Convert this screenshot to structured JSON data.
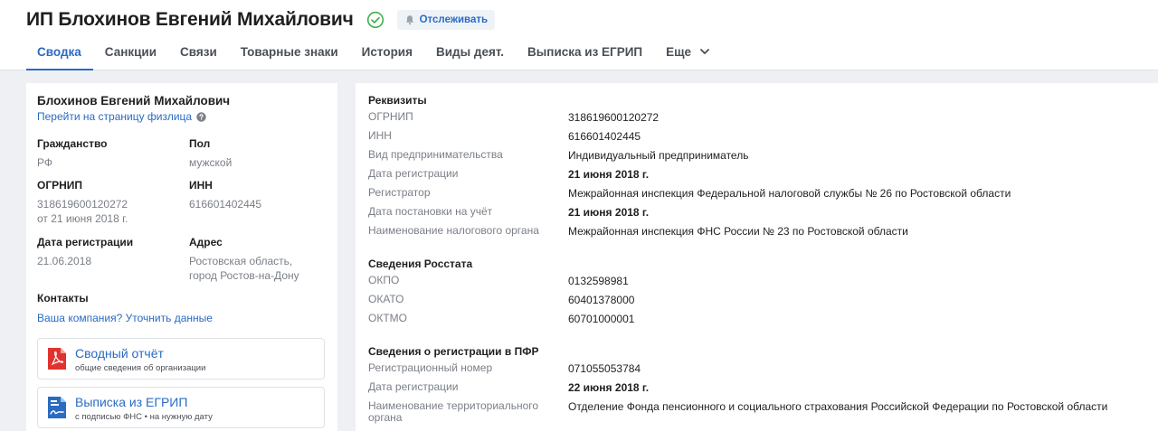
{
  "header": {
    "title": "ИП Блохинов Евгений Михайлович",
    "follow_label": "Отслеживать"
  },
  "tabs": [
    {
      "label": "Сводка"
    },
    {
      "label": "Санкции"
    },
    {
      "label": "Связи"
    },
    {
      "label": "Товарные знаки"
    },
    {
      "label": "История"
    },
    {
      "label": "Виды деят."
    },
    {
      "label": "Выписка из ЕГРИП"
    },
    {
      "label": "Еще"
    }
  ],
  "summary": {
    "name": "Блохинов Евгений Михайлович",
    "person_link": "Перейти на страницу физлица",
    "citizenship_label": "Гражданство",
    "citizenship_value": "РФ",
    "gender_label": "Пол",
    "gender_value": "мужской",
    "ogrnip_label": "ОГРНИП",
    "ogrnip_value": "318619600120272",
    "ogrnip_date": "от 21 июня 2018 г.",
    "inn_label": "ИНН",
    "inn_value": "616601402445",
    "regdate_label": "Дата регистрации",
    "regdate_value": "21.06.2018",
    "address_label": "Адрес",
    "address_line1": "Ростовская область,",
    "address_line2": "город Ростов-на-Дону",
    "contacts_label": "Контакты",
    "contacts_link": "Ваша компания? Уточнить данные",
    "cards": [
      {
        "title": "Сводный отчёт",
        "subtitle": "общие сведения об организации"
      },
      {
        "title": "Выписка из ЕГРИП",
        "subtitle": "с подписью ФНС • на нужную дату"
      }
    ]
  },
  "details": {
    "requisites": {
      "title": "Реквизиты",
      "rows": [
        {
          "key": "ОГРНИП",
          "value": "318619600120272"
        },
        {
          "key": "ИНН",
          "value": "616601402445"
        },
        {
          "key": "Вид предпринимательства",
          "value": "Индивидуальный предприниматель"
        },
        {
          "key": "Дата регистрации",
          "value": "21 июня 2018 г."
        },
        {
          "key": "Регистратор",
          "value": "Межрайонная инспекция Федеральной налоговой службы № 26 по Ростовской области"
        },
        {
          "key": "Дата постановки на учёт",
          "value": "21 июня 2018 г."
        },
        {
          "key": "Наименование налогового органа",
          "value": "Межрайонная инспекция ФНС России № 23 по Ростовской области"
        }
      ]
    },
    "rosstat": {
      "title": "Сведения Росстата",
      "rows": [
        {
          "key": "ОКПО",
          "value": "0132598981"
        },
        {
          "key": "ОКАТО",
          "value": "60401378000"
        },
        {
          "key": "ОКТМО",
          "value": "60701000001"
        }
      ]
    },
    "pfr": {
      "title": "Сведения о регистрации в ПФР",
      "rows": [
        {
          "key": "Регистрационный номер",
          "value": "071055053784"
        },
        {
          "key": "Дата регистрации",
          "value": "22 июня 2018 г."
        },
        {
          "key": "Наименование территориального органа",
          "value": "Отделение Фонда пенсионного и социального страхования Российской Федерации по Ростовской области"
        }
      ]
    }
  },
  "colors": {
    "accent": "#2a6bc3",
    "verified": "#3fb14f",
    "pdf_red": "#e0332f"
  }
}
